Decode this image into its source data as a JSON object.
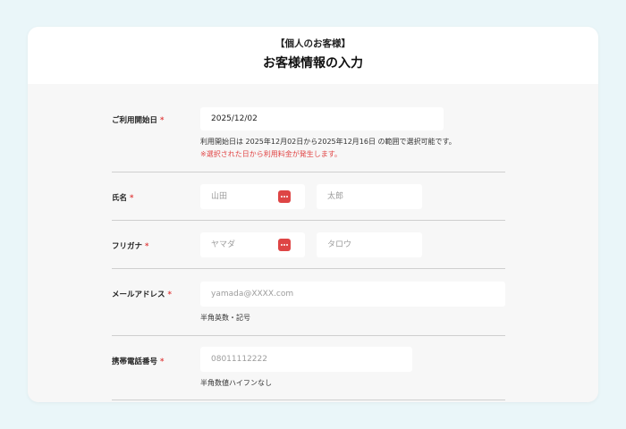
{
  "header": {
    "subtitle": "【個人のお客様】",
    "title": "お客様情報の入力"
  },
  "form": {
    "required_mark": "*",
    "start_date": {
      "label": "ご利用開始日",
      "value": "2025/12/02",
      "note": "利用開始日は 2025年12月02日から2025年12月16日 の範囲で選択可能です。",
      "warning": "※選択された日から利用料金が発生します。"
    },
    "name": {
      "label": "氏名",
      "last_placeholder": "山田",
      "first_placeholder": "太郎"
    },
    "kana": {
      "label": "フリガナ",
      "last_placeholder": "ヤマダ",
      "first_placeholder": "タロウ"
    },
    "email": {
      "label": "メールアドレス",
      "placeholder": "yamada@XXXX.com",
      "note": "半角英数・記号"
    },
    "phone": {
      "label": "携帯電話番号",
      "placeholder": "08011112222",
      "note": "半角数値ハイフンなし"
    }
  },
  "colors": {
    "background": "#eaf6f9",
    "required": "#e14545",
    "keyboard_icon": "#de4545"
  }
}
